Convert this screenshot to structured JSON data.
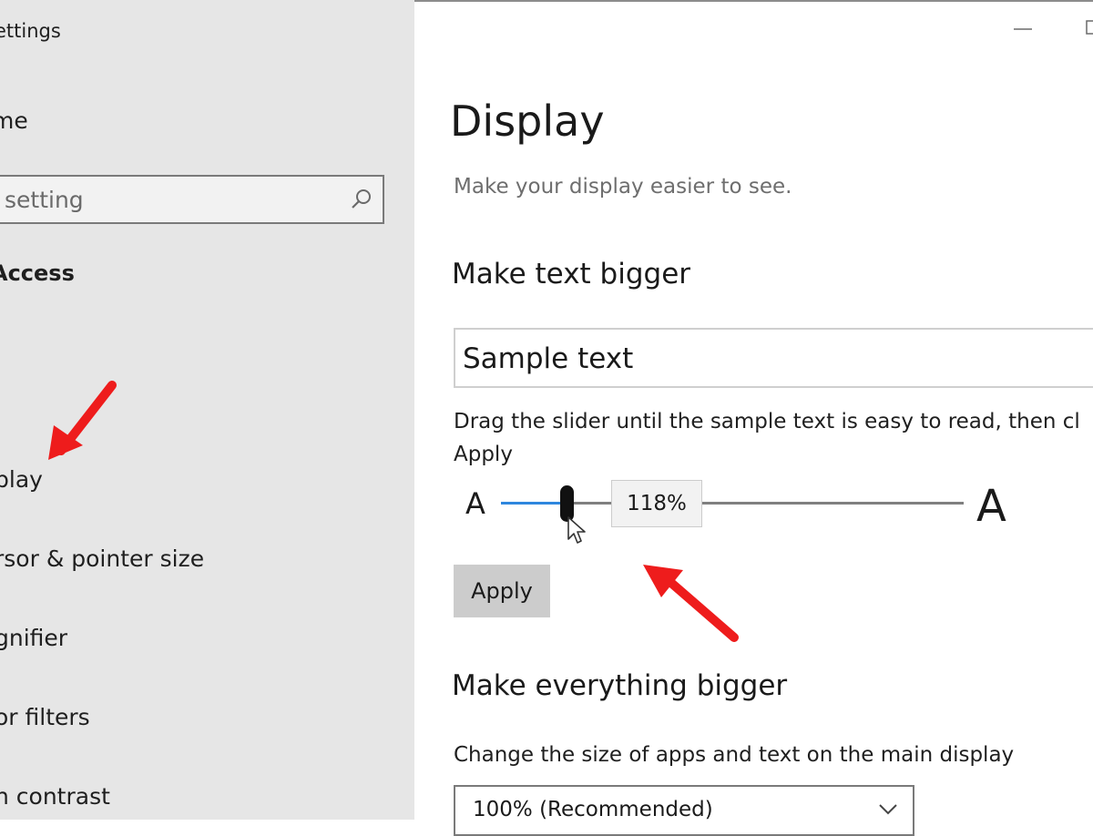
{
  "window": {
    "app_title": "Settings",
    "app_title_visible": "ettings",
    "controls": [
      "minimize",
      "maximize"
    ]
  },
  "sidebar": {
    "home_label": "me",
    "search": {
      "placeholder": "setting"
    },
    "group_title": "Access",
    "items": [
      {
        "label": "play",
        "selected": true
      },
      {
        "label": "rsor & pointer size"
      },
      {
        "label": "gnifier"
      },
      {
        "label": "or filters"
      },
      {
        "label": "h contrast"
      }
    ]
  },
  "main": {
    "title": "Display",
    "subtitle": "Make your display easier to see.",
    "text_section": {
      "title": "Make text bigger",
      "sample": "Sample text",
      "instructions": "Drag the slider until the sample text is easy to read, then cl Apply",
      "slider": {
        "small_label": "A",
        "large_label": "A",
        "value_label": "118%",
        "value": 118
      },
      "apply_label": "Apply"
    },
    "everything_section": {
      "title": "Make everything bigger",
      "description": "Change the size of apps and text on the main display",
      "selected": "100% (Recommended)"
    }
  },
  "colors": {
    "sidebar_bg": "#e6e6e6",
    "accent": "#2e86de",
    "annotation_arrow": "#ee1c1c"
  },
  "icons": [
    "search-icon",
    "minimize-icon",
    "maximize-icon",
    "mouse-cursor-icon",
    "chevron-down-icon",
    "red-arrow-icon"
  ]
}
